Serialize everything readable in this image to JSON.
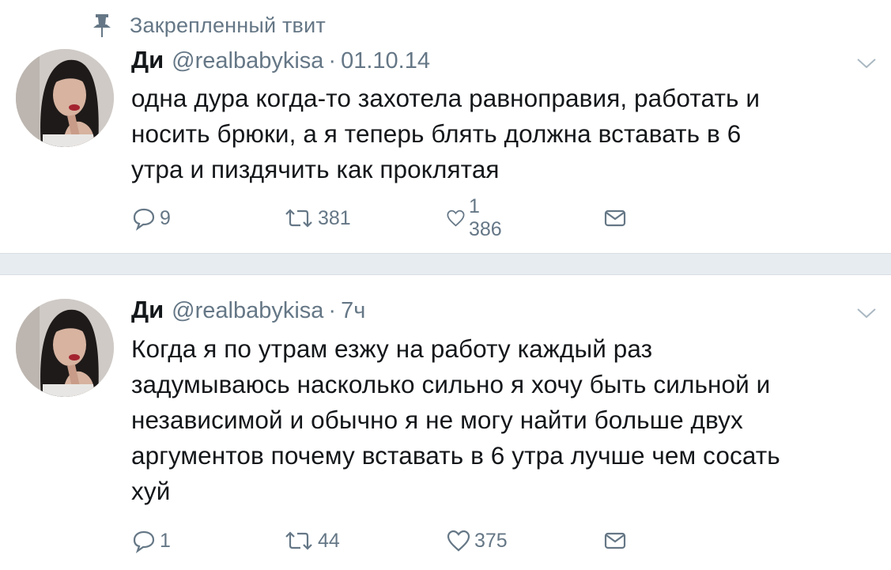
{
  "pinned": {
    "label": "Закрепленный твит",
    "icon": "pin-icon"
  },
  "tweets": [
    {
      "author": {
        "name": "Ди",
        "handle": "@realbabykisa"
      },
      "separator": "·",
      "time": "01.10.14",
      "text": "одна дура когда-то захотела равноправия, работать и\nносить брюки, а я теперь блять должна вставать в 6\nутра и пиздячить как проклятая",
      "replies": "9",
      "retweets": "381",
      "likes": "1 386"
    },
    {
      "author": {
        "name": "Ди",
        "handle": "@realbabykisa"
      },
      "separator": "·",
      "time": "7ч",
      "text": "Когда я по утрам езжу на работу каждый раз\nзадумываюсь насколько сильно я хочу быть сильной и\nнезависимой и обычно я не могу найти больше двух\nаргументов почему вставать в 6 утра лучше чем сосать\nхуй",
      "replies": "1",
      "retweets": "44",
      "likes": "375"
    }
  ],
  "colors": {
    "text": "#14171a",
    "secondary": "#657786",
    "separator": "#e6ecf0"
  }
}
